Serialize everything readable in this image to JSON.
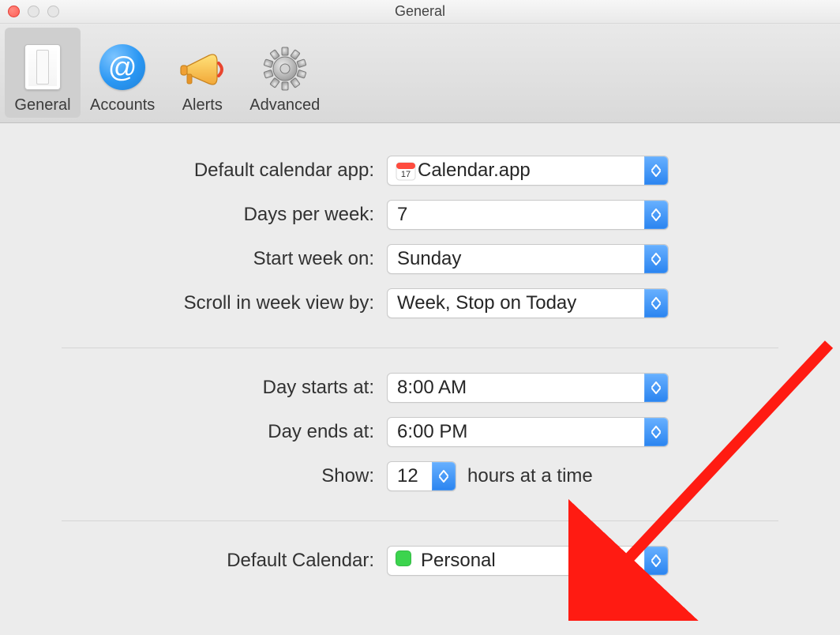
{
  "window": {
    "title": "General"
  },
  "toolbar": {
    "items": [
      {
        "label": "General",
        "active": true
      },
      {
        "label": "Accounts",
        "active": false
      },
      {
        "label": "Alerts",
        "active": false
      },
      {
        "label": "Advanced",
        "active": false
      }
    ]
  },
  "settings": {
    "default_app": {
      "label": "Default calendar app:",
      "value": "Calendar.app"
    },
    "days_per_week": {
      "label": "Days per week:",
      "value": "7"
    },
    "start_week_on": {
      "label": "Start week on:",
      "value": "Sunday"
    },
    "scroll_week": {
      "label": "Scroll in week view by:",
      "value": "Week, Stop on Today"
    },
    "day_starts": {
      "label": "Day starts at:",
      "value": "8:00 AM"
    },
    "day_ends": {
      "label": "Day ends at:",
      "value": "6:00 PM"
    },
    "show_hours": {
      "label": "Show:",
      "value": "12",
      "suffix": "hours at a time"
    },
    "default_calendar": {
      "label": "Default Calendar:",
      "value": "Personal",
      "color": "#3cd44e"
    }
  }
}
